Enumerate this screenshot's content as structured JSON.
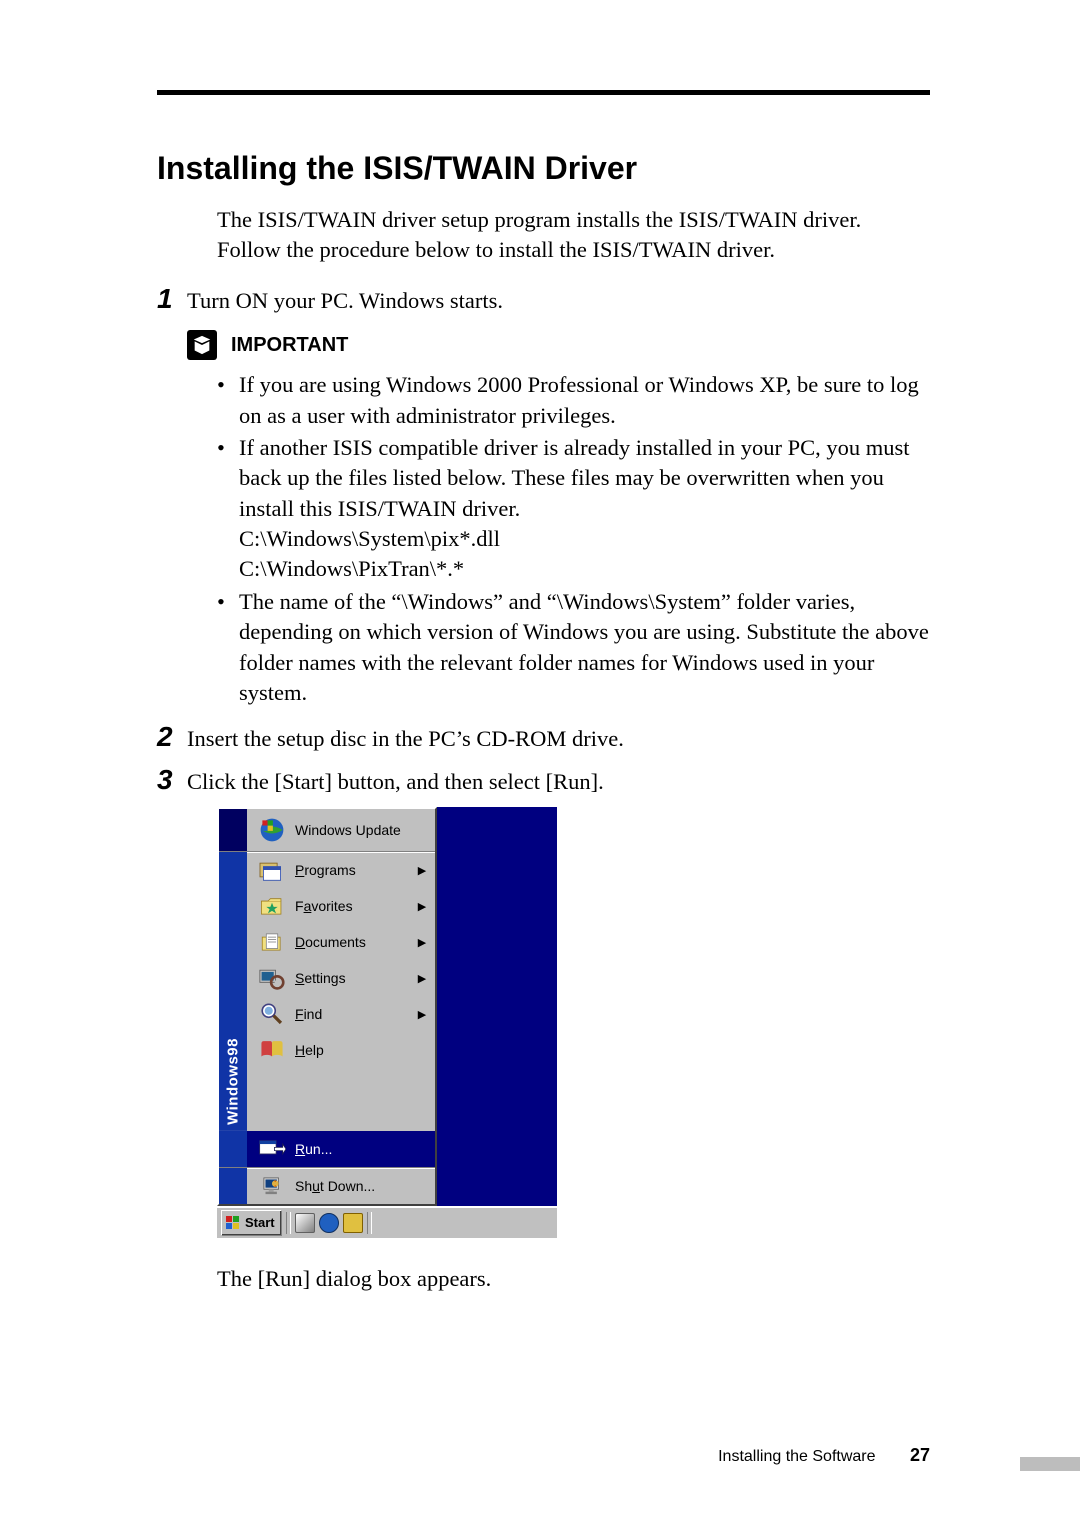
{
  "heading": "Installing the ISIS/TWAIN Driver",
  "intro": "The ISIS/TWAIN driver setup program installs the ISIS/TWAIN driver. Follow the procedure below to install the ISIS/TWAIN driver.",
  "steps": {
    "n1": "1",
    "t1": "Turn ON your PC. Windows starts.",
    "n2": "2",
    "t2": "Insert the setup disc in the PC’s CD-ROM drive.",
    "n3": "3",
    "t3": "Click the [Start] button, and then select [Run]."
  },
  "important_label": "IMPORTANT",
  "important": {
    "b1": "If you are using Windows 2000 Professional or Windows XP, be sure to log on as a user with administrator privileges.",
    "b2_l1": "If another ISIS compatible driver is already installed in your PC, you must back up the files listed below. These files may be overwritten when you install this ISIS/TWAIN driver.",
    "b2_l2": "C:\\Windows\\System\\pix*.dll",
    "b2_l3": "C:\\Windows\\PixTran\\*.*",
    "b3": "The name of the “\\Windows” and “\\Windows\\System” folder varies, depending on which version of Windows you are using. Substitute the above folder names with the relevant folder names for Windows used in your system."
  },
  "startmenu": {
    "sidebar": "Windows98",
    "update": "Windows Update",
    "programs": "Programs",
    "favorites": "Favorites",
    "documents": "Documents",
    "settings": "Settings",
    "find": "Find",
    "help": "Help",
    "run": "Run...",
    "shutdown": "Shut Down...",
    "start": "Start"
  },
  "icons": {
    "update": "windows-update-icon",
    "programs": "programs-icon",
    "favorites": "favorites-icon",
    "documents": "documents-icon",
    "settings": "settings-icon",
    "find": "find-icon",
    "help": "help-icon",
    "run": "run-icon",
    "shutdown": "shutdown-icon",
    "start_flag": "windows-flag-icon",
    "tray1": "desktop-icon",
    "tray2": "ie-icon",
    "tray3": "outlook-icon"
  },
  "after_shot": "The [Run] dialog box appears.",
  "footer_text": "Installing the Software",
  "page_number": "27"
}
